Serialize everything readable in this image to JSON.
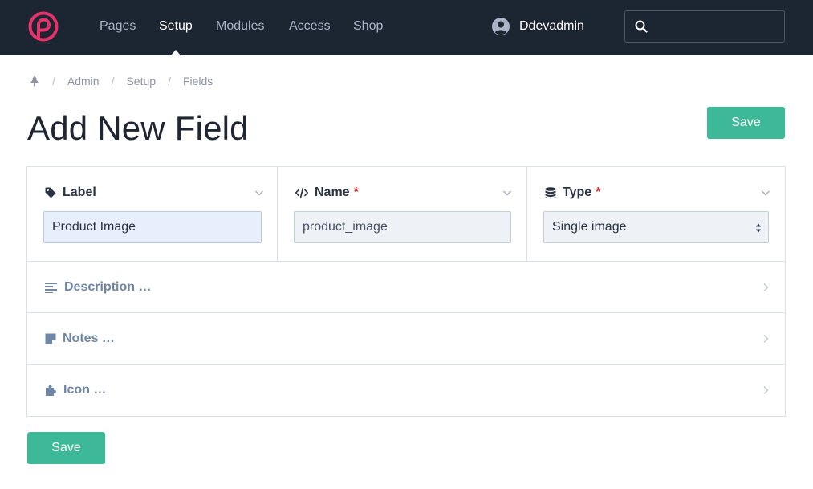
{
  "nav": {
    "items": [
      "Pages",
      "Setup",
      "Modules",
      "Access",
      "Shop"
    ],
    "active": "Setup",
    "user_name": "Ddevadmin",
    "search_placeholder": ""
  },
  "breadcrumb": {
    "home_icon": "tree-icon",
    "items": [
      "Admin",
      "Setup",
      "Fields"
    ]
  },
  "page": {
    "title": "Add New Field",
    "save_label": "Save"
  },
  "form": {
    "label": {
      "heading": "Label",
      "icon": "tag-icon",
      "value": "Product Image"
    },
    "name": {
      "heading": "Name",
      "icon": "code-icon",
      "required_mark": "*",
      "value": "product_image"
    },
    "type": {
      "heading": "Type",
      "icon": "database-icon",
      "required_mark": "*",
      "value": "Single image",
      "options": [
        "Single image"
      ]
    },
    "sections": [
      {
        "heading": "Description …",
        "icon": "align-left-icon"
      },
      {
        "heading": "Notes …",
        "icon": "sticky-note-icon"
      },
      {
        "heading": "Icon …",
        "icon": "puzzle-icon"
      }
    ]
  },
  "colors": {
    "topbar": "#1c2532",
    "accent": "#3eb998",
    "required": "#d32f2f",
    "section_heading": "#6f86a6"
  }
}
